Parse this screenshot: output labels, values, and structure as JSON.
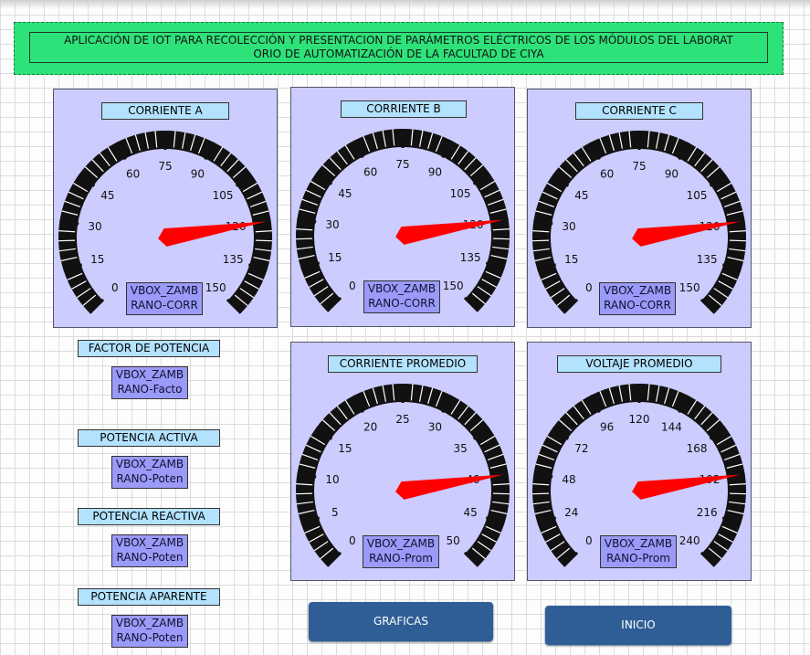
{
  "title": {
    "line1": "APLICACIÓN DE IOT  PARA RECOLECCIÓN   Y PRESENTACION DE PARÁMETROS ELÉCTRICOS DE LOS MÓDULOS  DEL LABORAT",
    "line2": "ORIO DE AUTOMATIZACIÓN DE LA FACULTAD DE CIYA"
  },
  "gauges": [
    {
      "id": "corriente-a",
      "label": "CORRIENTE A",
      "ticks": [
        "0",
        "15",
        "30",
        "45",
        "60",
        "75",
        "90",
        "105",
        "120",
        "135",
        "150"
      ],
      "min": 0,
      "max": 150,
      "value": 120,
      "tag": [
        "VBOX_ZAMB",
        "RANO-CORR"
      ]
    },
    {
      "id": "corriente-b",
      "label": "CORRIENTE B",
      "ticks": [
        "0",
        "15",
        "30",
        "45",
        "60",
        "75",
        "90",
        "105",
        "120",
        "135",
        "150"
      ],
      "min": 0,
      "max": 150,
      "value": 120,
      "tag": [
        "VBOX_ZAMB",
        "RANO-CORR"
      ]
    },
    {
      "id": "corriente-c",
      "label": "CORRIENTE C",
      "ticks": [
        "0",
        "15",
        "30",
        "45",
        "60",
        "75",
        "90",
        "105",
        "120",
        "135",
        "150"
      ],
      "min": 0,
      "max": 150,
      "value": 120,
      "tag": [
        "VBOX_ZAMB",
        "RANO-CORR"
      ]
    },
    {
      "id": "corriente-promedio",
      "label": "CORRIENTE PROMEDIO",
      "ticks": [
        "0",
        "5",
        "10",
        "15",
        "20",
        "25",
        "30",
        "35",
        "40",
        "45",
        "50"
      ],
      "min": 0,
      "max": 50,
      "value": 40,
      "tag": [
        "VBOX_ZAMB",
        "RANO-Prom"
      ]
    },
    {
      "id": "voltaje-promedio",
      "label": "VOLTAJE PROMEDIO",
      "ticks": [
        "0",
        "24",
        "48",
        "72",
        "96",
        "120",
        "144",
        "168",
        "192",
        "216",
        "240"
      ],
      "min": 0,
      "max": 240,
      "value": 192,
      "tag": [
        "VBOX_ZAMB",
        "RANO-Prom"
      ]
    }
  ],
  "readouts": [
    {
      "label": "FACTOR DE POTENCIA",
      "tag": [
        "VBOX_ZAMB",
        "RANO-Facto"
      ]
    },
    {
      "label": "POTENCIA ACTIVA",
      "tag": [
        "VBOX_ZAMB",
        "RANO-Poten"
      ]
    },
    {
      "label": "POTENCIA REACTIVA",
      "tag": [
        "VBOX_ZAMB",
        "RANO-Poten"
      ]
    },
    {
      "label": "POTENCIA APARENTE",
      "tag": [
        "VBOX_ZAMB",
        "RANO-Poten"
      ]
    }
  ],
  "buttons": {
    "graficas": "GRAFICAS",
    "inicio": "INICIO"
  },
  "colors": {
    "panel": "#ccccff",
    "label_bg": "#b3e2ff",
    "tag_bg": "#9a9af8",
    "needle": "#ff0000",
    "title_bg": "#2ee27a",
    "button": "#2f5e96"
  }
}
